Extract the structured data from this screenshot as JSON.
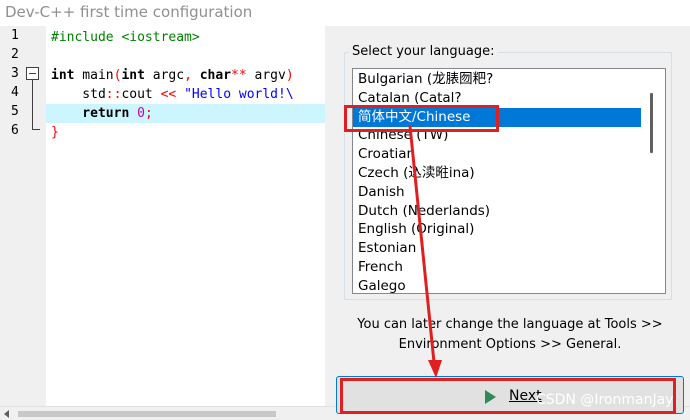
{
  "window": {
    "title": "Dev-C++ first time configuration"
  },
  "editor": {
    "line_numbers": [
      "1",
      "2",
      "3",
      "4",
      "5",
      "6"
    ],
    "lines": [
      {
        "tokens": [
          {
            "t": "#include <iostream>",
            "c": "pp"
          }
        ]
      },
      {
        "tokens": []
      },
      {
        "tokens": [
          {
            "t": "int",
            "c": "kw"
          },
          {
            "t": " main",
            "c": "id"
          },
          {
            "t": "(",
            "c": "op"
          },
          {
            "t": "int",
            "c": "kw"
          },
          {
            "t": " argc",
            "c": "id"
          },
          {
            "t": ", ",
            "c": "op"
          },
          {
            "t": "char",
            "c": "kw"
          },
          {
            "t": "**",
            "c": "op"
          },
          {
            "t": " argv",
            "c": "id"
          },
          {
            "t": ")",
            "c": "op"
          }
        ]
      },
      {
        "tokens": [
          {
            "t": "    std",
            "c": "id"
          },
          {
            "t": "::",
            "c": "op"
          },
          {
            "t": "cout ",
            "c": "id"
          },
          {
            "t": "<<",
            "c": "op"
          },
          {
            "t": " \"Hello world!\\",
            "c": "str"
          }
        ]
      },
      {
        "tokens": [
          {
            "t": "    return",
            "c": "kw"
          },
          {
            "t": " ",
            "c": "id"
          },
          {
            "t": "0",
            "c": "num"
          },
          {
            "t": ";",
            "c": "op"
          }
        ],
        "highlighted": true
      },
      {
        "tokens": [
          {
            "t": "}",
            "c": "op"
          }
        ]
      }
    ]
  },
  "language_panel": {
    "label": "Select your language:",
    "items": [
      "Bulgarian (龙脿囫粑?",
      "Catalan (Catal?",
      "简体中文/Chinese",
      "Chinese (TW)",
      "Croatian",
      "Czech (込渎暀ina)",
      "Danish",
      "Dutch (Nederlands)",
      "English (Original)",
      "Estonian",
      "French",
      "Galego"
    ],
    "selected_index": 2
  },
  "hint": {
    "line1": "You can later change the language at Tools >>",
    "line2": "Environment Options >> General."
  },
  "next_button": {
    "label": "Next"
  },
  "watermark": "CSDN @IronmanJay",
  "colors": {
    "selection": "#0078d7",
    "annotation": "#e02020",
    "highlight_line": "#ccf5ff"
  }
}
